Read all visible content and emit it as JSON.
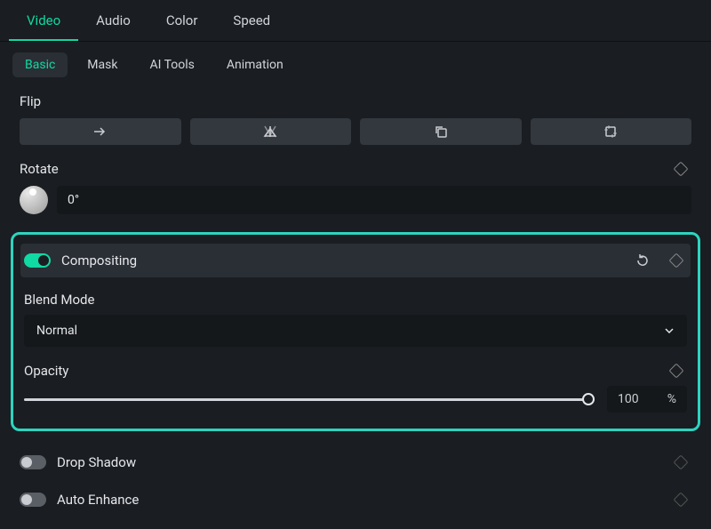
{
  "main_tabs": {
    "video": "Video",
    "audio": "Audio",
    "color": "Color",
    "speed": "Speed"
  },
  "sub_tabs": {
    "basic": "Basic",
    "mask": "Mask",
    "ai_tools": "AI Tools",
    "animation": "Animation"
  },
  "flip": {
    "label": "Flip"
  },
  "rotate": {
    "label": "Rotate",
    "value": "0°"
  },
  "compositing": {
    "label": "Compositing",
    "enabled": true,
    "blend_mode_label": "Blend Mode",
    "blend_mode_value": "Normal",
    "opacity_label": "Opacity",
    "opacity_value": "100",
    "opacity_unit": "%"
  },
  "drop_shadow": {
    "label": "Drop Shadow",
    "enabled": false
  },
  "auto_enhance": {
    "label": "Auto Enhance",
    "enabled": false
  }
}
